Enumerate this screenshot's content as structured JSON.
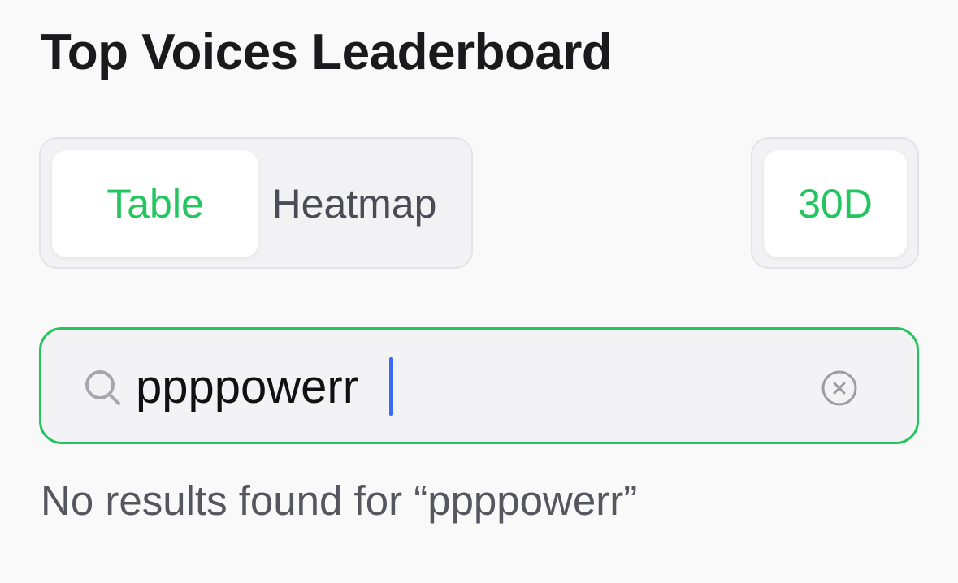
{
  "header": {
    "title": "Top Voices Leaderboard"
  },
  "view_switch": {
    "options": [
      {
        "label": "Table",
        "selected": true
      },
      {
        "label": "Heatmap",
        "selected": false
      }
    ]
  },
  "range_switch": {
    "options": [
      {
        "label": "30D",
        "selected": true
      }
    ]
  },
  "search": {
    "value": "ppppowerr",
    "icon": "search-icon",
    "clear_icon": "clear-circle-icon"
  },
  "results": {
    "empty_message": "No results found for “ppppowerr”"
  },
  "colors": {
    "accent": "#22c55e",
    "caret": "#3b6cf5",
    "background": "#f9f9fa"
  }
}
